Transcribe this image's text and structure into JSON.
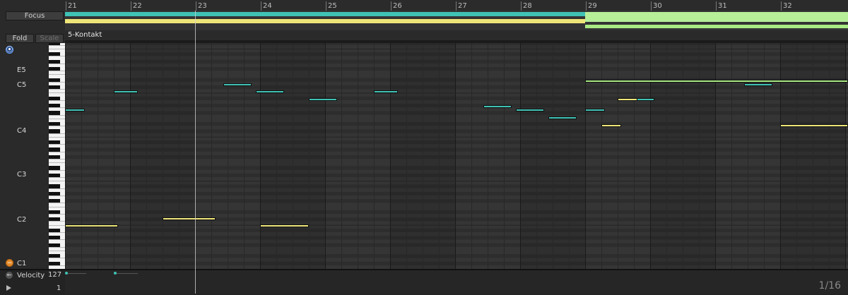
{
  "buttons": {
    "focus": "Focus",
    "fold": "Fold",
    "scale": "Scale"
  },
  "clip": {
    "name": "5-Kontakt"
  },
  "ruler": {
    "bars": [
      "21",
      "22",
      "23",
      "24",
      "25",
      "26",
      "27",
      "28",
      "29",
      "30",
      "31",
      "32"
    ]
  },
  "keyboard": {
    "octave_labels": [
      "E5",
      "C5",
      "C4",
      "C3",
      "C2",
      "C1"
    ]
  },
  "velocity": {
    "label": "Velocity",
    "max": "127",
    "min": "1"
  },
  "grid": {
    "quantization": "1/16"
  },
  "icons": [
    "target-icon",
    "fold-octave-icon",
    "expand-velocity-icon",
    "play-icon"
  ],
  "colors": {
    "teal": "#3fc2b5",
    "yellow": "#efe67a",
    "green": "#a9ea84",
    "background": "#1e1e1e"
  }
}
